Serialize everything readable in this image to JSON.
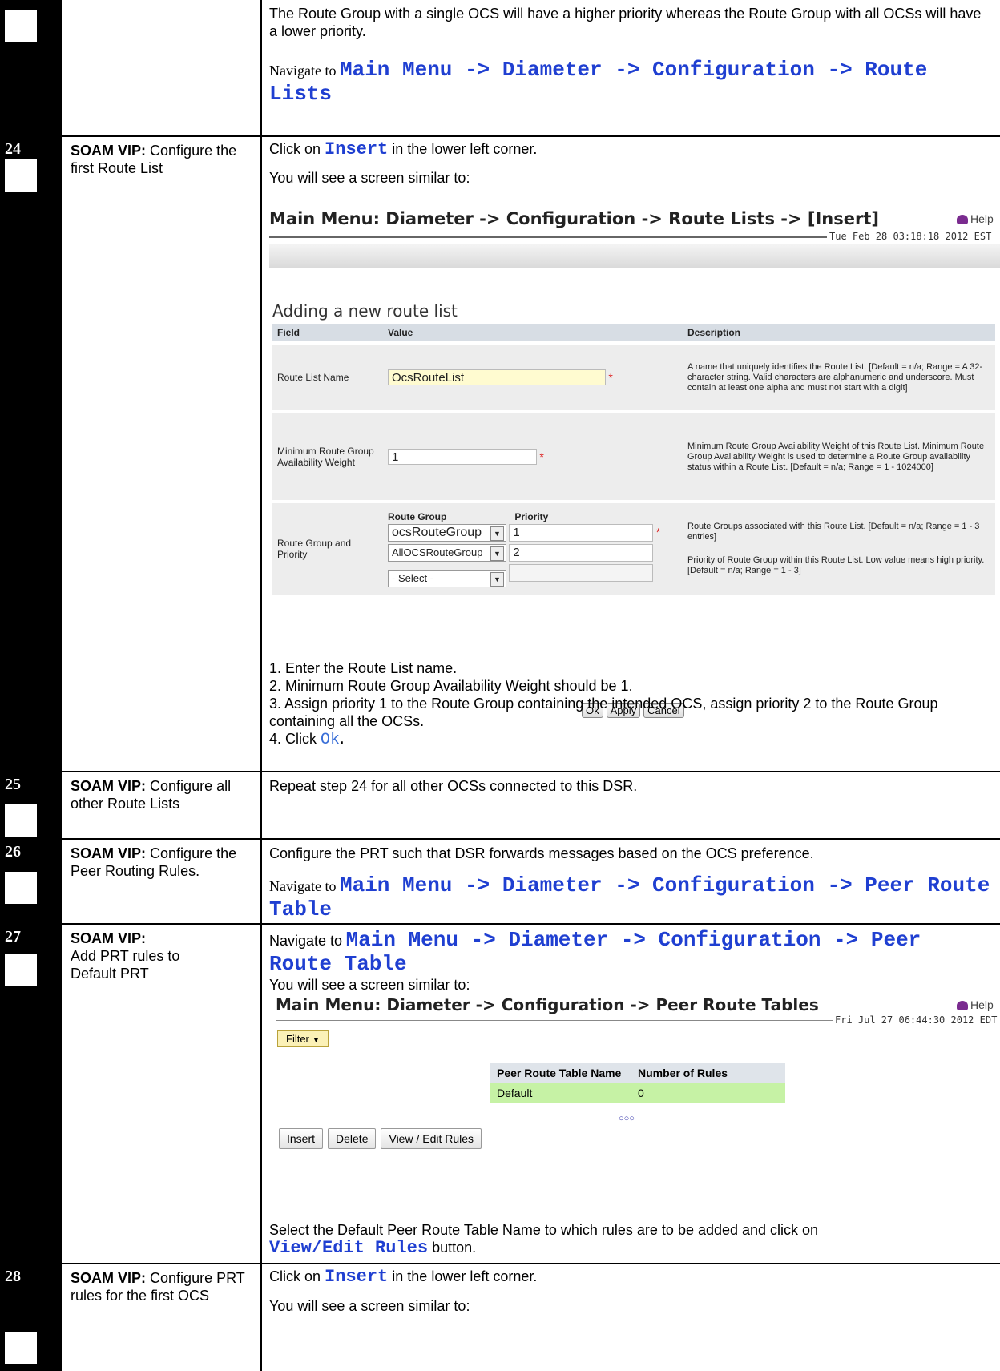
{
  "row_top": {
    "text1": "The Route Group with a single OCS will have a higher priority whereas the Route Group with all OCSs will have a lower priority.",
    "nav_prefix": "Navigate to",
    "nav_path": "Main Menu -> Diameter -> Configuration -> Route Lists"
  },
  "step24": {
    "number": "24",
    "label_bold": "SOAM VIP:",
    "label_text": "Configure the first Route List",
    "click_prefix": "Click on",
    "click_target": "Insert",
    "click_suffix": "in the lower left corner.",
    "see_text": "You will see a screen similar to:",
    "screenshot": {
      "title": "Main Menu: Diameter -> Configuration -> Route Lists -> [Insert]",
      "help": "Help",
      "datetime": "Tue Feb 28 03:18:18 2012 EST",
      "section_heading": "Adding a new route list",
      "headers": [
        "Field",
        "Value",
        "Description"
      ],
      "route_list_name_label": "Route List Name",
      "route_list_name_value": "OcsRouteList",
      "route_list_name_desc": "A name that uniquely identifies the Route List. [Default = n/a; Range = A 32-character string. Valid characters are alphanumeric and underscore. Must contain at least one alpha and must not start with a digit]",
      "min_weight_label": "Minimum Route Group Availability Weight",
      "min_weight_value": "1",
      "min_weight_desc": "Minimum Route Group Availability Weight of this Route List. Minimum Route Group Availability Weight is used to determine a Route Group availability status within a Route List. [Default = n/a; Range = 1 - 1024000]",
      "rg_label": "Route Group and Priority",
      "rg_col_group": "Route Group",
      "rg_col_priority": "Priority",
      "rg_rows": [
        {
          "group": "ocsRouteGroup",
          "priority": "1"
        },
        {
          "group": "AllOCSRouteGroup",
          "priority": "2"
        },
        {
          "group": "- Select -",
          "priority": ""
        }
      ],
      "rg_desc1": "Route Groups associated with this Route List. [Default = n/a; Range = 1 - 3 entries]",
      "rg_desc2": "Priority of Route Group within this Route List. Low value means high priority. [Default = n/a; Range = 1 - 3]",
      "buttons": [
        "Ok",
        "Apply",
        "Cancel"
      ]
    },
    "instr1": "1. Enter the Route List name.",
    "instr2": "2. Minimum Route Group Availability Weight should be 1.",
    "instr3": "3. Assign priority 1 to the Route Group containing the intended OCS, assign priority 2 to the Route Group containing all the OCSs.",
    "instr4_prefix": "4. Click",
    "instr4_target": "Ok",
    "instr4_suffix": "."
  },
  "step25": {
    "number": "25",
    "label_bold": "SOAM VIP:",
    "label_text": "Configure all other  Route Lists",
    "text": "Repeat step 24 for all other OCSs connected to this DSR."
  },
  "step26": {
    "number": "26",
    "label_bold": "SOAM VIP:",
    "label_text": "Configure the Peer Routing Rules.",
    "text": "Configure the PRT such that DSR forwards messages based on the OCS preference.",
    "nav_prefix": "Navigate to",
    "nav_path": "Main Menu -> Diameter -> Configuration -> Peer Route Table"
  },
  "step27": {
    "number": "27",
    "label_bold": "SOAM VIP:",
    "label_text": "Add PRT rules to Default PRT",
    "nav_prefix": "Navigate to",
    "nav_path": "Main Menu -> Diameter -> Configuration -> Peer Route Table",
    "see_text": "You will see a screen similar to:",
    "screenshot": {
      "title": "Main Menu: Diameter -> Configuration -> Peer Route Tables",
      "help": "Help",
      "datetime": "Fri Jul 27 06:44:30 2012 EDT",
      "filter": "Filter",
      "col_name": "Peer Route Table Name",
      "col_rules": "Number of Rules",
      "row_name": "Default",
      "row_rules": "0",
      "buttons": [
        "Insert",
        "Delete",
        "View / Edit Rules"
      ]
    },
    "select_text": "Select the Default Peer Route Table Name to which rules are to be added and click on",
    "select_target": "View/Edit Rules",
    "select_suffix": "button."
  },
  "step28": {
    "number": "28",
    "label_bold": "SOAM VIP:",
    "label_text": "Configure PRT rules  for the first OCS",
    "click_prefix": "Click on",
    "click_target": "Insert",
    "click_suffix": "in the lower left corner.",
    "see_text": "You will see a screen similar to:"
  }
}
